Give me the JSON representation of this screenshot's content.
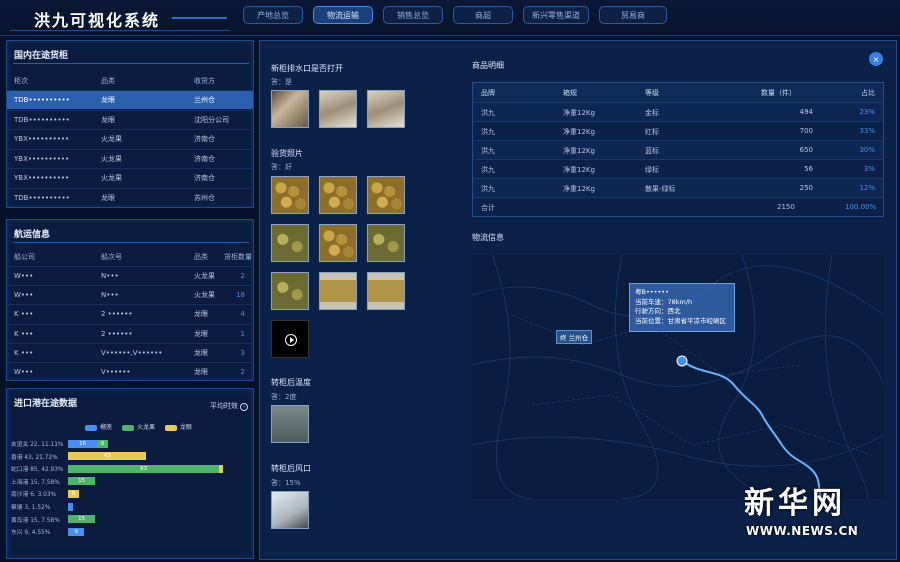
{
  "app": {
    "title": "洪九可视化系统"
  },
  "tabs": [
    "产地总览",
    "物流运输",
    "销售总览",
    "商超",
    "新兴零售渠道",
    "贸易商"
  ],
  "active_tab": "物流运输",
  "containers": {
    "title": "国内在途货柜",
    "headers": [
      "柜次",
      "品类",
      "收货方"
    ],
    "rows": [
      [
        "TDB••••••••••",
        "龙眼",
        "兰州仓"
      ],
      [
        "TDB••••••••••",
        "龙眼",
        "沈阳分公司"
      ],
      [
        "YBX••••••••••",
        "火龙果",
        "济南仓"
      ],
      [
        "YBX••••••••••",
        "火龙果",
        "济南仓"
      ],
      [
        "YBX••••••••••",
        "火龙果",
        "济南仓"
      ],
      [
        "TDB••••••••••",
        "龙眼",
        "苏州仓"
      ]
    ]
  },
  "shipping": {
    "title": "航运信息",
    "headers": [
      "船公司",
      "船次号",
      "品类",
      "货柜数量"
    ],
    "rows": [
      [
        "W•••",
        "N•••",
        "火龙果",
        "2"
      ],
      [
        "W•••",
        "N•••",
        "火龙果",
        "18"
      ],
      [
        "K •••",
        "2 ••••••",
        "龙眼",
        "4"
      ],
      [
        "K •••",
        "2 ••••••",
        "龙眼",
        "1"
      ],
      [
        "K •••",
        "V••••••,V••••••",
        "龙眼",
        "3"
      ],
      [
        "W•••",
        "V••••••",
        "龙眼",
        "2"
      ]
    ]
  },
  "ports": {
    "title": "进口港在途数据",
    "link": "平均时效",
    "legend": [
      "榴莲",
      "火龙果",
      "龙眼"
    ],
    "rows": [
      {
        "label": "友谊关 22, 11.11%",
        "segments": [
          {
            "series": "榴莲",
            "value": 16
          },
          {
            "series": "火龙果",
            "value": 6
          }
        ]
      },
      {
        "label": "香港 43, 21.72%",
        "segments": [
          {
            "series": "龙眼",
            "value": 43
          }
        ]
      },
      {
        "label": "蛇口港 85, 42.93%",
        "segments": [
          {
            "series": "火龙果",
            "value": 83
          },
          {
            "series": "龙眼",
            "value": 2
          }
        ]
      },
      {
        "label": "上海港 15, 7.58%",
        "segments": [
          {
            "series": "火龙果",
            "value": 15
          }
        ]
      },
      {
        "label": "南沙港 6, 3.03%",
        "segments": [
          {
            "series": "龙眼",
            "value": 6
          }
        ]
      },
      {
        "label": "蔡塘 3, 1.52%",
        "segments": [
          {
            "series": "榴莲",
            "value": 3
          }
        ]
      },
      {
        "label": "黄岛港 15, 7.58%",
        "segments": [
          {
            "series": "火龙果",
            "value": 15
          }
        ]
      },
      {
        "label": "东兴 9, 4.55%",
        "segments": [
          {
            "series": "榴莲",
            "value": 9
          }
        ]
      }
    ],
    "colors": {
      "榴莲": "#4a8ef0",
      "火龙果": "#4fb36b",
      "龙眼": "#e8c95a"
    }
  },
  "detail": {
    "q1": "新柜排水口是否打开",
    "a1": "答：是",
    "q2": "验货照片",
    "a2": "答：好",
    "q3": "转柜后温度",
    "a3": "答：2度",
    "q4": "转柜后风口",
    "a4": "答：15%"
  },
  "goods": {
    "title": "商品明细",
    "headers": [
      "品牌",
      "箱规",
      "等级",
      "数量（件）",
      "占比"
    ],
    "rows": [
      [
        "洪九",
        "净重12Kg",
        "金标",
        "494",
        "23%"
      ],
      [
        "洪九",
        "净重12Kg",
        "红标",
        "700",
        "33%"
      ],
      [
        "洪九",
        "净重12Kg",
        "蓝标",
        "650",
        "30%"
      ],
      [
        "洪九",
        "净重12Kg",
        "绿标",
        "56",
        "3%"
      ],
      [
        "洪九",
        "净重12Kg",
        "散果-绿标",
        "250",
        "12%"
      ]
    ],
    "total": [
      "合计",
      "",
      "",
      "2150",
      "100.00%"
    ]
  },
  "logistics": {
    "title": "物流信息",
    "plate": "粤B••••••",
    "speed": "当前车速：78km/h",
    "direction": "行驶方向：西北",
    "location": "当前位置：甘肃省平凉市崆峒区",
    "warehouse": "终 兰州仓"
  },
  "close_icon": "×",
  "watermark": {
    "cn": "新华网",
    "en": "WWW.NEWS.CN"
  }
}
